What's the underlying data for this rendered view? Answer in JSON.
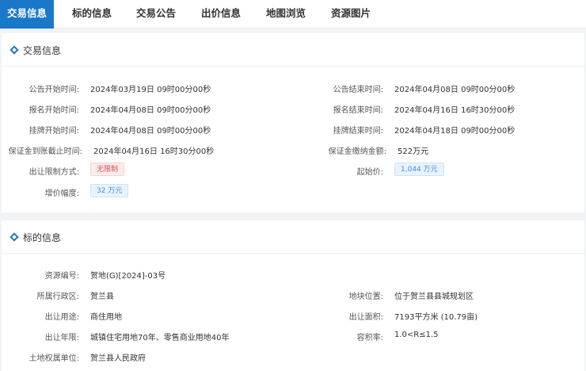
{
  "tabs": [
    {
      "label": "交易信息"
    },
    {
      "label": "标的信息"
    },
    {
      "label": "交易公告"
    },
    {
      "label": "出价信息"
    },
    {
      "label": "地图浏览"
    },
    {
      "label": "资源图片"
    }
  ],
  "trade": {
    "title": "交易信息",
    "notice_start_label": "公告开始时间:",
    "notice_start": "2024年03月19日 09时00分00秒",
    "notice_end_label": "公告结束时间:",
    "notice_end": "2024年04月08日 09时00分00秒",
    "signup_start_label": "报名开始时间:",
    "signup_start": "2024年04月08日 09时00分00秒",
    "signup_end_label": "报名结束时间:",
    "signup_end": "2024年04月16日 16时30分00秒",
    "listing_start_label": "挂牌开始时间:",
    "listing_start": "2024年04月08日 09时00分00秒",
    "listing_end_label": "挂牌结束时间:",
    "listing_end": "2024年04月18日 09时00分00秒",
    "deposit_deadline_label": "保证金到账截止时间:",
    "deposit_deadline": "2024年04月16日 16时30分00秒",
    "deposit_amount_label": "保证金缴纳金额:",
    "deposit_amount": "522万元",
    "restriction_label": "出让限制方式:",
    "restriction": "无限制",
    "start_price_label": "起始价:",
    "start_price": "1,044 万元",
    "increment_label": "增价幅度:",
    "increment": "32 万元"
  },
  "target": {
    "title": "标的信息",
    "resource_no_label": "资源编号:",
    "resource_no": "贺地(G)[2024]-03号",
    "district_label": "所属行政区:",
    "district": "贺兰县",
    "location_label": "地块位置:",
    "location": "位于贺兰县县城规划区",
    "usage_label": "出让用途:",
    "usage": "商住用地",
    "area_label": "出让面积:",
    "area": "7193平方米 (10.79亩)",
    "years_label": "出让年限:",
    "years": "城镇住宅用地70年、零售商业用地40年",
    "far_label": "容积率:",
    "far": "1.0<R≤1.5",
    "owner_label": "土地权属单位:",
    "owner": "贺兰县人民政府"
  }
}
